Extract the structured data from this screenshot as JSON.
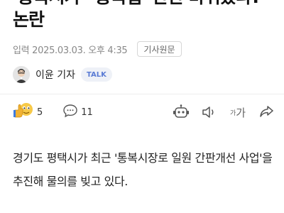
{
  "article": {
    "headline": "'통복시가' '통복입' 간판 바꿔놨다?\n논란",
    "date": "입력 2025.03.03. 오후 4:35",
    "source_button": "기사원문",
    "author": "이윤 기자",
    "talk_badge": "TALK",
    "reaction_count": "5",
    "comment_count": "11",
    "font_label": "가",
    "font_label_small": "가",
    "body": "경기도 평택시가 최근 '통복시장로 일원 간판개선 사업'을 추진해 물의를 빚고 있다."
  },
  "colors": {
    "accent": "#5a7bd4",
    "meta": "#888888"
  },
  "icons": [
    "avatar",
    "reaction-emoji-icon",
    "comment-icon",
    "summary-bot-icon",
    "audio-icon",
    "font-size-icon",
    "share-icon"
  ]
}
